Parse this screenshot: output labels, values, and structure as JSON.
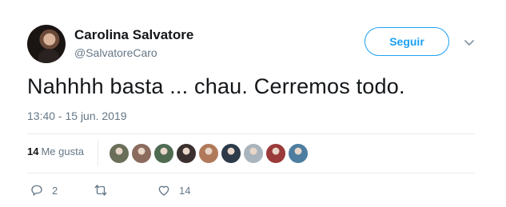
{
  "tweet": {
    "author_name": "Carolina Salvatore",
    "author_handle": "@SalvatoreCaro",
    "follow_label": "Seguir",
    "text": "Nahhhh basta ... chau. Cerremos todo.",
    "timestamp": "13:40 - 15 jun. 2019",
    "likes_count": "14",
    "likes_label": "Me gusta",
    "reply_count": "2",
    "like_count": "14"
  },
  "colors": {
    "accent": "#1da1f2",
    "secondary_text": "#657786",
    "divider": "#e6ecf0"
  },
  "likers": [
    {
      "color": "#6a6f5a"
    },
    {
      "color": "#8b6b5e"
    },
    {
      "color": "#4e6b52"
    },
    {
      "color": "#3a3030"
    },
    {
      "color": "#b07a5a"
    },
    {
      "color": "#2c3a4a"
    },
    {
      "color": "#aab4bd"
    },
    {
      "color": "#9b3a3a"
    },
    {
      "color": "#4d7ea0"
    }
  ],
  "icons": {
    "reply": "reply-icon",
    "retweet": "retweet-icon",
    "like": "heart-icon",
    "menu": "chevron-down-icon"
  }
}
